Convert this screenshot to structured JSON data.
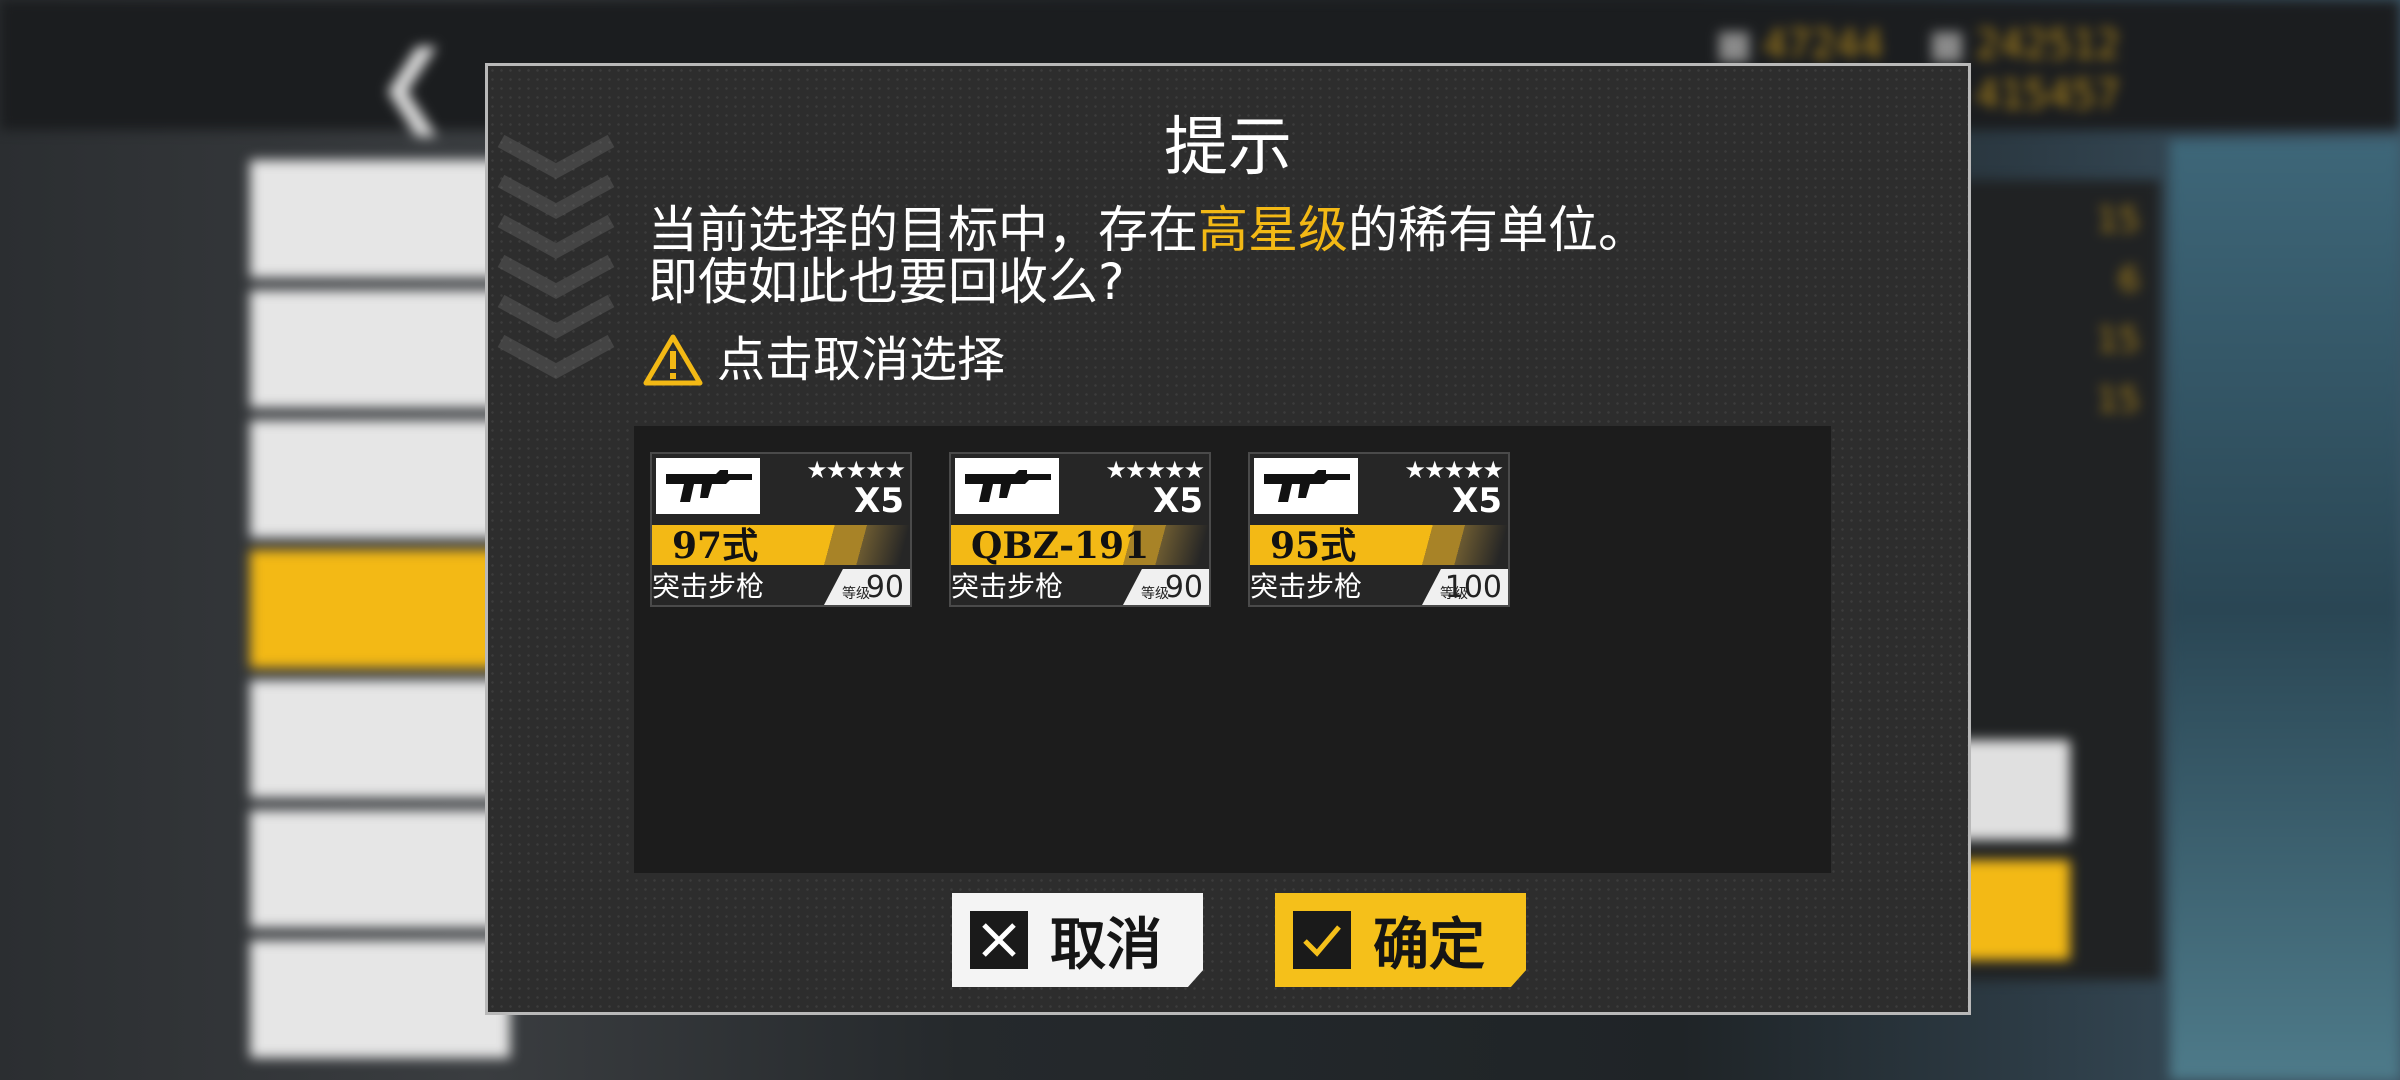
{
  "background": {
    "resources": [
      "47244",
      "242512",
      "415457"
    ],
    "right_numbers": [
      "15",
      "6",
      "15",
      "15"
    ]
  },
  "dialog": {
    "title": "提示",
    "message_before": "当前选择的目标中，存在",
    "message_highlight": "高星级",
    "message_after": "的稀有单位。",
    "message_line2": "即使如此也要回收么?",
    "hint": "点击取消选择",
    "cards": [
      {
        "name": "97式",
        "type": "突击步枪",
        "stars": "★★★★★",
        "count": "X5",
        "level_label": "等级",
        "level": "90"
      },
      {
        "name": "QBZ-191",
        "type": "突击步枪",
        "stars": "★★★★★",
        "count": "X5",
        "level_label": "等级",
        "level": "90"
      },
      {
        "name": "95式",
        "type": "突击步枪",
        "stars": "★★★★★",
        "count": "X5",
        "level_label": "等级",
        "level": "100"
      }
    ],
    "cancel_label": "取消",
    "confirm_label": "确定"
  },
  "colors": {
    "accent": "#f3b915",
    "dialog_bg": "#2d2d2d",
    "panel_bg": "#1c1c1c"
  },
  "icons": [
    "back-arrow-icon",
    "warning-icon",
    "rifle-icon",
    "close-x-icon",
    "check-icon"
  ]
}
